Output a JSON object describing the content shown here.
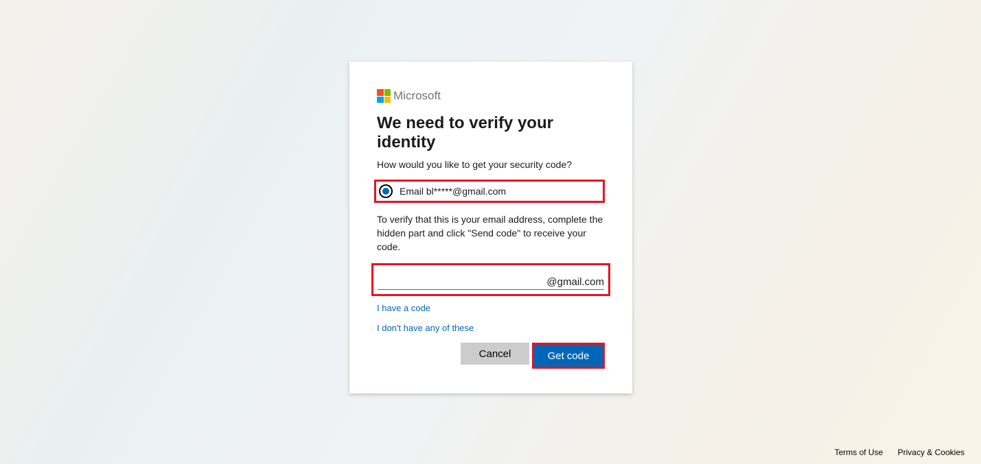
{
  "brand": {
    "name": "Microsoft"
  },
  "card": {
    "title": "We need to verify your identity",
    "subtitle": "How would you like to get your security code?",
    "radio_option_label": "Email bl*****@gmail.com",
    "instruction": "To verify that this is your email address, complete the hidden part and click \"Send code\" to receive your code.",
    "email_suffix": "@gmail.com",
    "email_value": "",
    "link_have_code": "I have a code",
    "link_none": "I don't have any of these",
    "button_cancel": "Cancel",
    "button_get_code": "Get code"
  },
  "footer": {
    "terms": "Terms of Use",
    "privacy": "Privacy & Cookies"
  }
}
